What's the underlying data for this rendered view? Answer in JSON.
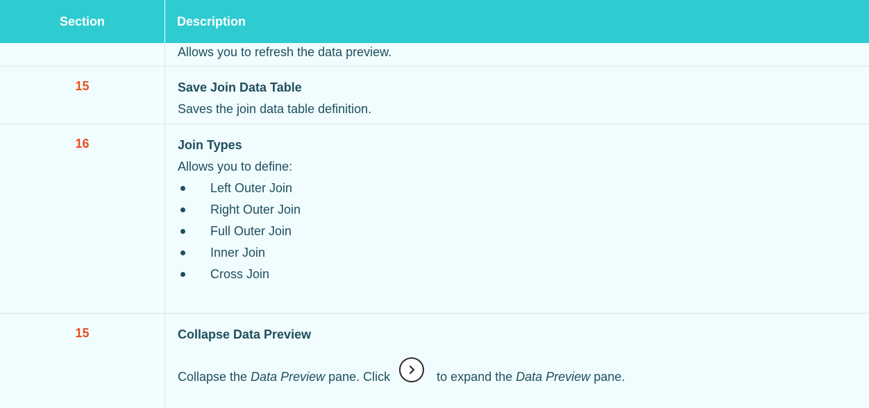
{
  "header": {
    "section": "Section",
    "description": "Description"
  },
  "rows": [
    {
      "section": "",
      "title": "",
      "description": "Allows you to refresh the data preview."
    },
    {
      "section": "15",
      "title": "Save Join Data Table",
      "description": "Saves the join data table definition."
    },
    {
      "section": "16",
      "title": "Join Types",
      "description": "Allows you to define:",
      "bullets": [
        "Left Outer Join",
        "Right Outer Join",
        "Full Outer Join",
        "Inner Join",
        "Cross Join"
      ]
    },
    {
      "section": "15",
      "title": "Collapse Data Preview",
      "desc_parts": [
        "Collapse the ",
        "Data Preview",
        " pane. Click ",
        " to expand the ",
        "Data Preview",
        " pane."
      ],
      "icon": "chevron-right-circle-icon"
    }
  ],
  "colors": {
    "header_bg": "#2ecbd1",
    "section_number": "#e84e1b",
    "text": "#1f4e5f",
    "row_bg": "#f0fcfd"
  }
}
